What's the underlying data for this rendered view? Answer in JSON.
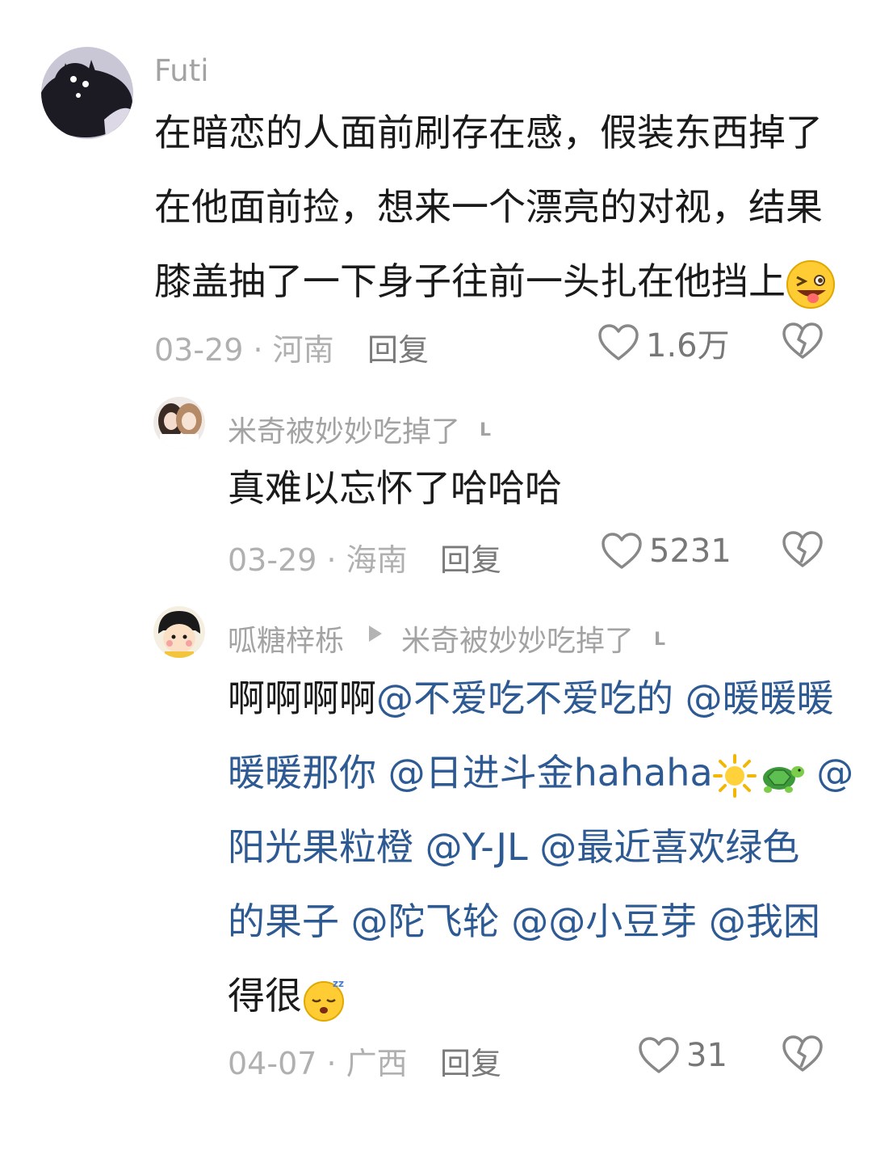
{
  "comments": [
    {
      "username": "Futi",
      "lines": [
        "在暗恋的人面前刷存在感，假装东西掉了",
        "在他面前捡，想来一个漂亮的对视，结果",
        "膝盖抽了一下身子往前一头扎在他挡上"
      ],
      "emoji": "squinting-tongue-face-emoji",
      "date_location": "03-29 · 河南",
      "reply_label": "回复",
      "like_count": "1.6万",
      "avatar": "black-cat-avatar"
    },
    {
      "username": "米奇被妙妙吃掉了",
      "badge": "L",
      "text": "真难以忘怀了哈哈哈",
      "date_location": "03-29 · 海南",
      "reply_label": "回复",
      "like_count": "5231",
      "avatar": "two-girls-avatar"
    },
    {
      "username": "呱糖梓栎",
      "reply_to": "米奇被妙妙吃掉了",
      "badge": "L",
      "segments": {
        "s1": "啊啊啊啊",
        "m1": "@不爱吃不爱吃的",
        "m2a": "@暖暖暖",
        "m2b": "暖暖那你",
        "m3": "@日进斗金hahaha",
        "m4a": "@",
        "m4b": "阳光果粒橙",
        "m5": "@Y-JL",
        "m6a": "@最近喜欢绿色",
        "m6b": "的果子",
        "m7": "@陀飞轮",
        "m8": "@@小豆芽",
        "m9": "@我困",
        "s2": "得很"
      },
      "emojis": [
        "sun-emoji",
        "turtle-emoji",
        "sleeping-face-emoji"
      ],
      "date_location": "04-07 · 广西",
      "reply_label": "回复",
      "like_count": "31",
      "avatar": "cartoon-girl-avatar"
    }
  ],
  "colors": {
    "background": "#ffffff",
    "text": "#1a1a1a",
    "mention": "#2e5a93",
    "meta": "#b0b0b0",
    "username": "#a3a3a3"
  }
}
